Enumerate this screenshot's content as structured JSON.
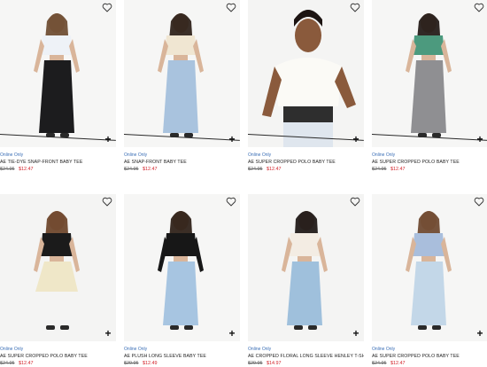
{
  "products": [
    {
      "badge": "Online Only",
      "name": "AE TIE-DYE SNAP-FRONT BABY TEE",
      "was": "$24.95",
      "now": "$12.47",
      "top_color": "#eef2f7",
      "bottom_color": "#1c1c1e",
      "hair": "#6b4a2f",
      "bg": "#f6f6f5"
    },
    {
      "badge": "Online Only",
      "name": "AE SNAP-FRONT BABY TEE",
      "was": "$24.95",
      "now": "$12.47",
      "top_color": "#f0e6d2",
      "bottom_color": "#a9c3de",
      "hair": "#2a1d16",
      "bg": "#f6f6f5"
    },
    {
      "badge": "Online Only",
      "name": "AE SUPER CROPPED POLO BABY TEE",
      "was": "$24.95",
      "now": "$12.47",
      "top_color": "#fbfaf6",
      "bottom_color": "#2e2e2e",
      "hair": "#1c1412",
      "bg": "#f4f4f3"
    },
    {
      "badge": "Online Only",
      "name": "AE SUPER CROPPED POLO BABY TEE",
      "was": "$24.95",
      "now": "$12.47",
      "top_color": "#4c9a7e",
      "bottom_color": "#8f8f92",
      "hair": "#1f1714",
      "bg": "#f6f6f5"
    },
    {
      "badge": "Online Only",
      "name": "AE SUPER CROPPED POLO BABY TEE",
      "was": "$24.95",
      "now": "$12.47",
      "top_color": "#1b1b1b",
      "bottom_color": "#efe7c8",
      "hair": "#6a4228",
      "bg": "#f4f4f3"
    },
    {
      "badge": "Online Only",
      "name": "AE PLUSH LONG SLEEVE BABY TEE",
      "was": "$29.95",
      "now": "$12.49",
      "top_color": "#171717",
      "bottom_color": "#a7c5e1",
      "hair": "#2a1c14",
      "bg": "#f6f6f5"
    },
    {
      "badge": "Online Only",
      "name": "AE CROPPED FLORAL LONG SLEEVE HENLEY T-SHIRT",
      "was": "$29.95",
      "now": "$14.97",
      "top_color": "#f3ece3",
      "bottom_color": "#9fc0dc",
      "hair": "#1a1412",
      "bg": "#f4f4f3"
    },
    {
      "badge": "Online Only",
      "name": "AE SUPER CROPPED POLO BABY TEE",
      "was": "$24.95",
      "now": "$12.47",
      "top_color": "#a9bedc",
      "bottom_color": "#c3d7e8",
      "hair": "#6b452c",
      "bg": "#f6f6f5"
    }
  ],
  "icons": {
    "favorite": "heart-icon",
    "add": "plus-icon"
  }
}
